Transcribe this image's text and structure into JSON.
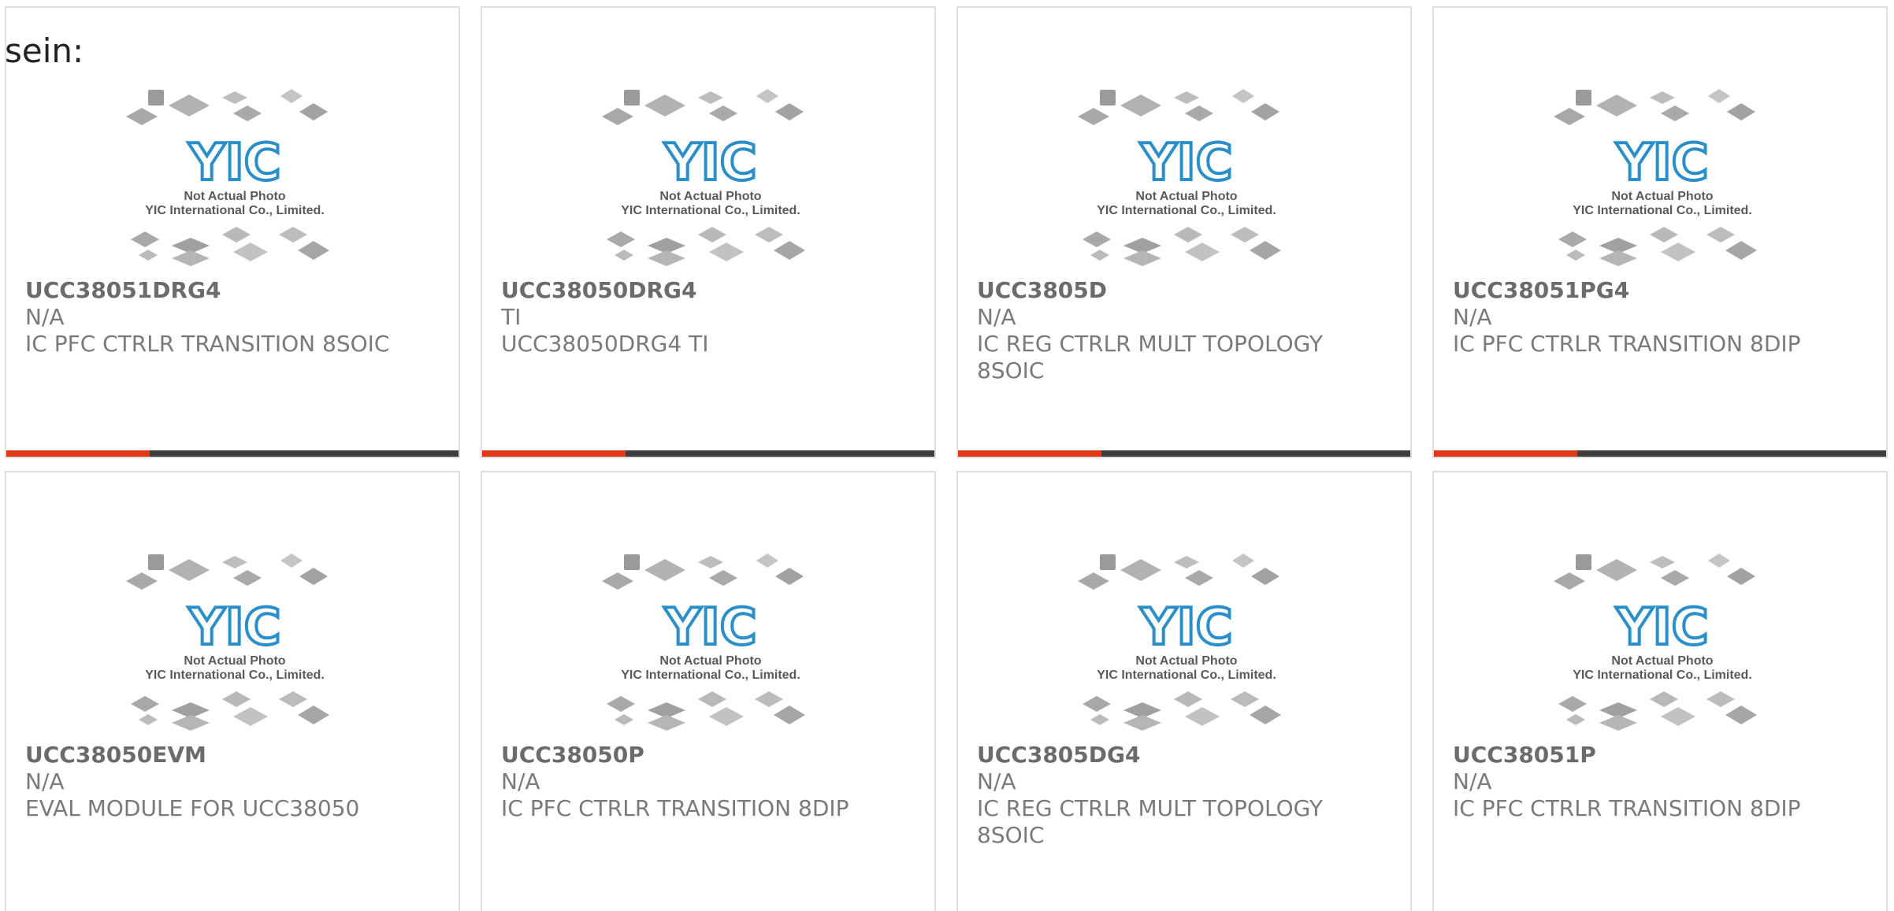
{
  "intro_text": "sein:",
  "photo_caption_line1": "Not Actual Photo",
  "photo_caption_line2": "YIC International Co., Limited.",
  "logo_text": "YIC",
  "products": [
    {
      "part": "UCC38051DRG4",
      "mfr": "N/A",
      "desc": "IC PFC CTRLR TRANSITION 8SOIC"
    },
    {
      "part": "UCC38050DRG4",
      "mfr": "TI",
      "desc": "UCC38050DRG4 TI"
    },
    {
      "part": "UCC3805D",
      "mfr": "N/A",
      "desc": "IC REG CTRLR MULT TOPOLOGY 8SOIC"
    },
    {
      "part": "UCC38051PG4",
      "mfr": "N/A",
      "desc": "IC PFC CTRLR TRANSITION 8DIP"
    },
    {
      "part": "UCC38050EVM",
      "mfr": "N/A",
      "desc": "EVAL MODULE FOR UCC38050"
    },
    {
      "part": "UCC38050P",
      "mfr": "N/A",
      "desc": "IC PFC CTRLR TRANSITION 8DIP"
    },
    {
      "part": "UCC3805DG4",
      "mfr": "N/A",
      "desc": "IC REG CTRLR MULT TOPOLOGY 8SOIC"
    },
    {
      "part": "UCC38051P",
      "mfr": "N/A",
      "desc": "IC PFC CTRLR TRANSITION 8DIP"
    }
  ],
  "colors": {
    "accent": "#e0391a",
    "bar": "#3d3d3d",
    "logo": "#2a8fc9"
  }
}
